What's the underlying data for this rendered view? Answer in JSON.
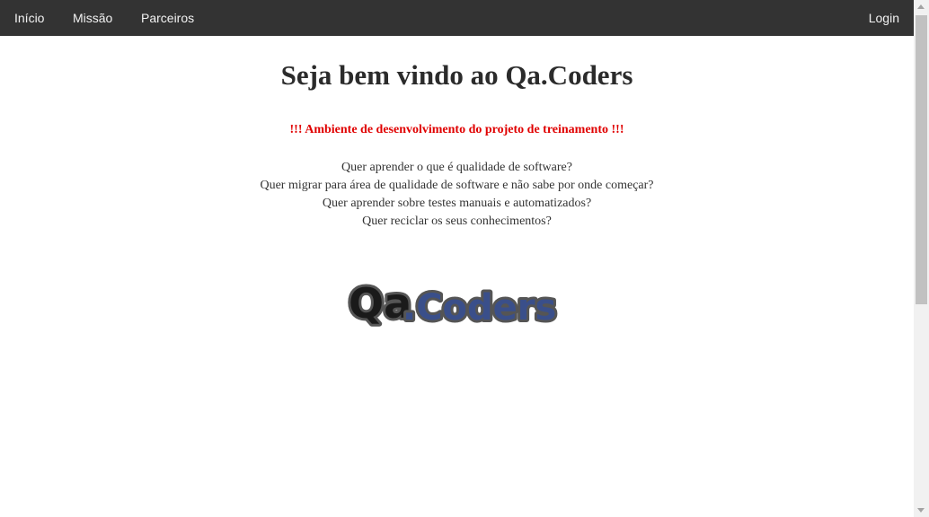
{
  "navbar": {
    "items": [
      {
        "label": "Início"
      },
      {
        "label": "Missão"
      },
      {
        "label": "Parceiros"
      }
    ],
    "login_label": "Login",
    "background": "#333333",
    "text_color": "#f2f2f2"
  },
  "main": {
    "title": "Seja bem vindo ao Qa.Coders",
    "warning": "!!! Ambiente de desenvolvimento do projeto de treinamento !!!",
    "warning_color": "#e00000",
    "questions": [
      "Quer aprender o que é qualidade de software?",
      "Quer migrar para área de qualidade de software e não sabe por onde começar?",
      "Quer aprender sobre testes manuais e automatizados?",
      "Quer reciclar os seus conhecimentos?"
    ],
    "logo": {
      "text_part1": "Qa",
      "text_part2": ".Coders",
      "icon": "qa-coders-logo",
      "colors": {
        "dark": "#1a1a1a",
        "blue": "#3a4f8a"
      }
    }
  }
}
